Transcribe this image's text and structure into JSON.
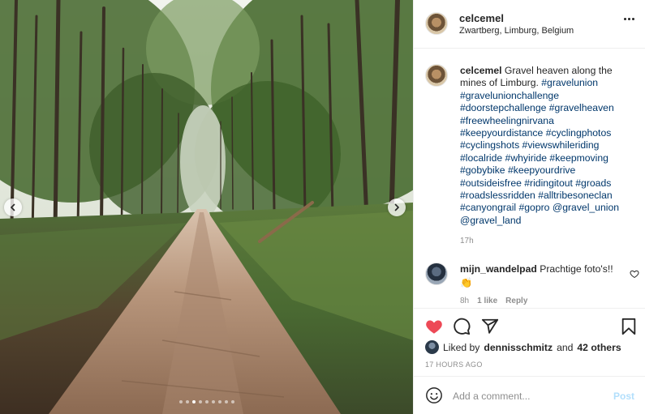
{
  "post": {
    "username": "celcemel",
    "location": "Zwartberg, Limburg, Belgium",
    "more_icon": "more-horizontal-icon"
  },
  "photo": {
    "carousel_dots": 9,
    "active_dot_index": 2,
    "prev_icon": "chevron-left-icon",
    "next_icon": "chevron-right-icon"
  },
  "caption": {
    "username": "celcemel",
    "text": "Gravel heaven along the mines of Limburg.",
    "tags": "#gravelunion #gravelunionchallenge #doorstepchallenge #gravelheaven #freewheelingnirvana #keepyourdistance #cyclingphotos #cyclingshots #viewswhileriding #localride #whyiride #keepmoving #gobybike #keepyourdrive #outsideisfree #ridingitout #groads #roadslessridden #alltribesoneclan #canyongrail #gopro @gravel_union @gravel_land",
    "time_ago": "17h"
  },
  "comment": {
    "username": "mijn_wandelpad",
    "text": "Prachtige foto's!!",
    "emoji": "👏",
    "time_ago": "8h",
    "likes": "1 like",
    "reply_label": "Reply"
  },
  "actions": {
    "liked_prefix": "Liked by",
    "liked_user": "dennisschmitz",
    "liked_and": "and",
    "liked_others": "42 others",
    "post_time": "17 HOURS AGO",
    "like_color": "#ed4956"
  },
  "add_comment": {
    "placeholder": "Add a comment...",
    "post_label": "Post",
    "post_color": "#b2dffc"
  }
}
